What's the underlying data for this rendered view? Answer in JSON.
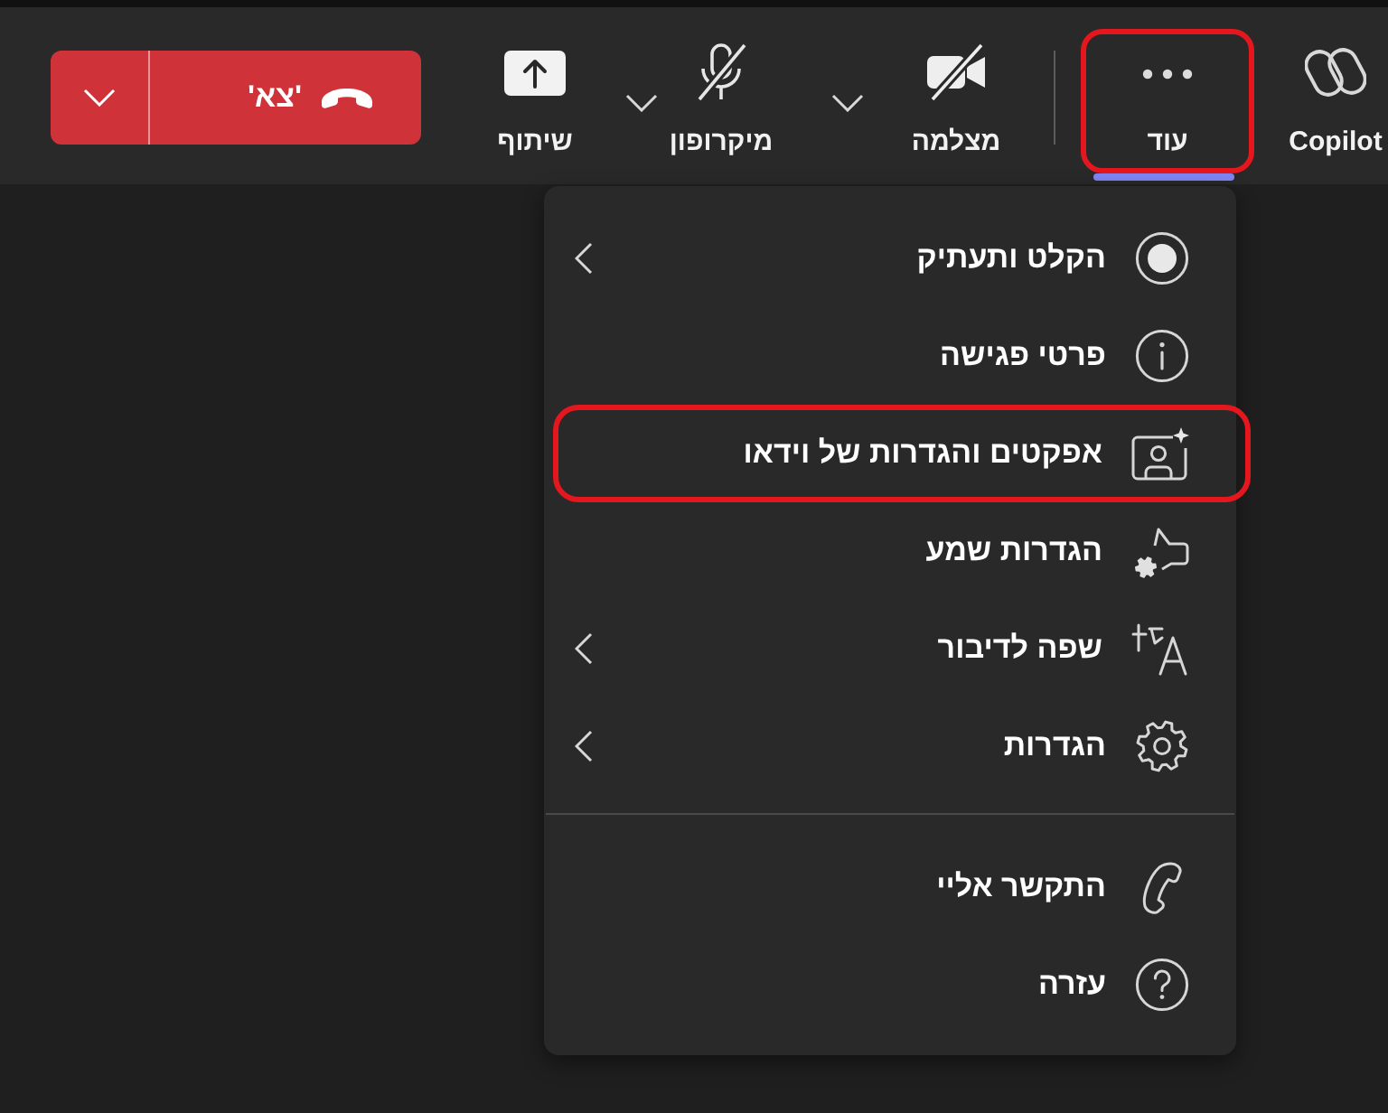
{
  "toolbar": {
    "extras": [
      {
        "kind": "copilot",
        "label": "Copilot",
        "selected": false,
        "highlighted": false
      },
      {
        "kind": "more",
        "label": "עוד",
        "selected": true,
        "highlighted": true
      }
    ],
    "devices": [
      {
        "kind": "camera",
        "label": "מצלמה",
        "on": false,
        "dropdown": true
      },
      {
        "kind": "microphone",
        "label": "מיקרופון",
        "on": false,
        "dropdown": true
      },
      {
        "kind": "share",
        "label": "שיתוף",
        "dropdown": false
      }
    ],
    "leave_button": {
      "label": "'צא'",
      "dropdown": true
    }
  },
  "more_menu": {
    "sections": [
      {
        "items": [
          {
            "kind": "record",
            "label": "הקלט ותעתיק",
            "submenu": true,
            "highlighted": false
          },
          {
            "kind": "info",
            "label": "פרטי פגישה",
            "submenu": false,
            "highlighted": false
          },
          {
            "kind": "effects",
            "label": "אפקטים והגדרות של וידאו",
            "submenu": false,
            "highlighted": true
          },
          {
            "kind": "audio",
            "label": "הגדרות שמע",
            "submenu": false,
            "highlighted": false
          },
          {
            "kind": "language",
            "label": "שפה לדיבור",
            "submenu": true,
            "highlighted": false
          },
          {
            "kind": "settings",
            "label": "הגדרות",
            "submenu": true,
            "highlighted": false
          }
        ]
      },
      {
        "items": [
          {
            "kind": "callme",
            "label": "התקשר אליי",
            "submenu": false,
            "highlighted": false
          },
          {
            "kind": "help",
            "label": "עזרה",
            "submenu": false,
            "highlighted": false
          }
        ]
      }
    ]
  }
}
